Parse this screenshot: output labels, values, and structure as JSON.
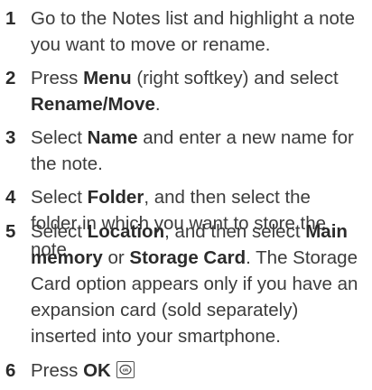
{
  "steps": [
    {
      "number": "1",
      "lines": [
        [
          {
            "t": "Go to the Notes list and highlight a note"
          }
        ],
        [
          {
            "t": "you want to move or rename."
          }
        ]
      ]
    },
    {
      "number": "2",
      "lines": [
        [
          {
            "t": "Press "
          },
          {
            "t": "Menu",
            "b": true
          },
          {
            "t": " (right softkey) and select"
          }
        ],
        [
          {
            "t": "Rename/Move",
            "b": true
          },
          {
            "t": "."
          }
        ]
      ]
    },
    {
      "number": "3",
      "lines": [
        [
          {
            "t": "Select "
          },
          {
            "t": "Name",
            "b": true
          },
          {
            "t": " and enter a new name for"
          }
        ],
        [
          {
            "t": "the note."
          }
        ]
      ]
    },
    {
      "number": "4",
      "lines": [
        [
          {
            "t": "Select "
          },
          {
            "t": "Folder",
            "b": true
          },
          {
            "t": ", and then select the"
          }
        ],
        [
          {
            "t": "folder in which you want to store the"
          }
        ],
        [
          {
            "t": "note."
          }
        ]
      ]
    },
    {
      "number": "5",
      "lines": [
        [
          {
            "t": "Select "
          },
          {
            "t": "Location",
            "b": true
          },
          {
            "t": ", and then select "
          },
          {
            "t": "Main",
            "b": true
          }
        ],
        [
          {
            "t": "memory",
            "b": true
          },
          {
            "t": " or "
          },
          {
            "t": "Storage Card",
            "b": true
          },
          {
            "t": ". The Storage"
          }
        ],
        [
          {
            "t": "Card option appears only if you have an"
          }
        ],
        [
          {
            "t": "expansion card (sold separately)"
          }
        ],
        [
          {
            "t": "inserted into your smartphone."
          }
        ]
      ]
    },
    {
      "number": "6",
      "lines": [
        [
          {
            "t": "Press "
          },
          {
            "t": "OK",
            "b": true
          },
          {
            "icon": "ok-key-icon"
          }
        ]
      ]
    }
  ]
}
